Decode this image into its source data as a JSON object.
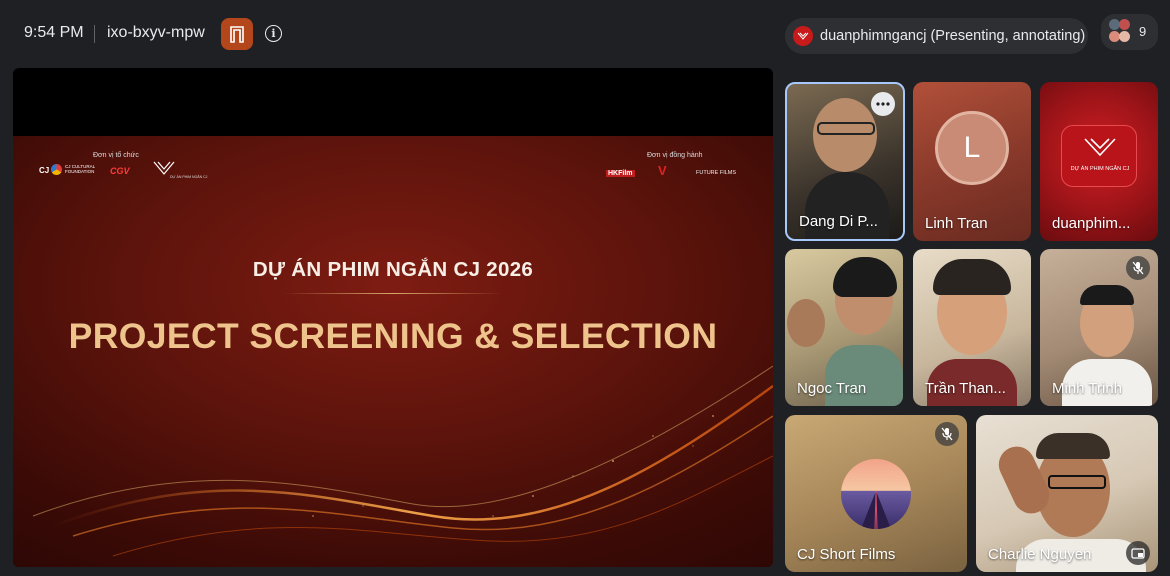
{
  "topbar": {
    "time": "9:54 PM",
    "meeting_code": "ixo-bxyv-mpw",
    "presenter_label": "duanphimngancj (Presenting, annotating)",
    "participant_count": "9"
  },
  "slide": {
    "organizer_label": "Đơn vị tổ chức",
    "companion_label": "Đơn vị đồng hành",
    "organizer_logos": [
      "CJ CULTURAL FOUNDATION",
      "CGV",
      "DỰ ÁN PHIM NGẮN CJ"
    ],
    "companion_logos": [
      "HKFilm",
      "V",
      "FUTURE FILMS"
    ],
    "subtitle": "DỰ ÁN PHIM NGẮN CJ 2026",
    "title": "PROJECT SCREENING & SELECTION"
  },
  "tiles": [
    {
      "name": "Dang Di P...",
      "muted": false
    },
    {
      "name": "Linh Tran",
      "initial": "L",
      "muted": false
    },
    {
      "name": "duanphim...",
      "logo_text": "DỰ ÁN PHIM NGẮN CJ",
      "muted": false
    },
    {
      "name": "Ngoc Tran",
      "muted": false
    },
    {
      "name": "Trần Than...",
      "muted": false
    },
    {
      "name": "Minh Trinh",
      "muted": true
    },
    {
      "name": "CJ Short Films",
      "muted": true
    },
    {
      "name": "Charlie Nguyen",
      "muted": false
    }
  ],
  "colors": {
    "background": "#1e2024",
    "accent_orange": "#b3461b",
    "title_gold": "#efc38c"
  }
}
